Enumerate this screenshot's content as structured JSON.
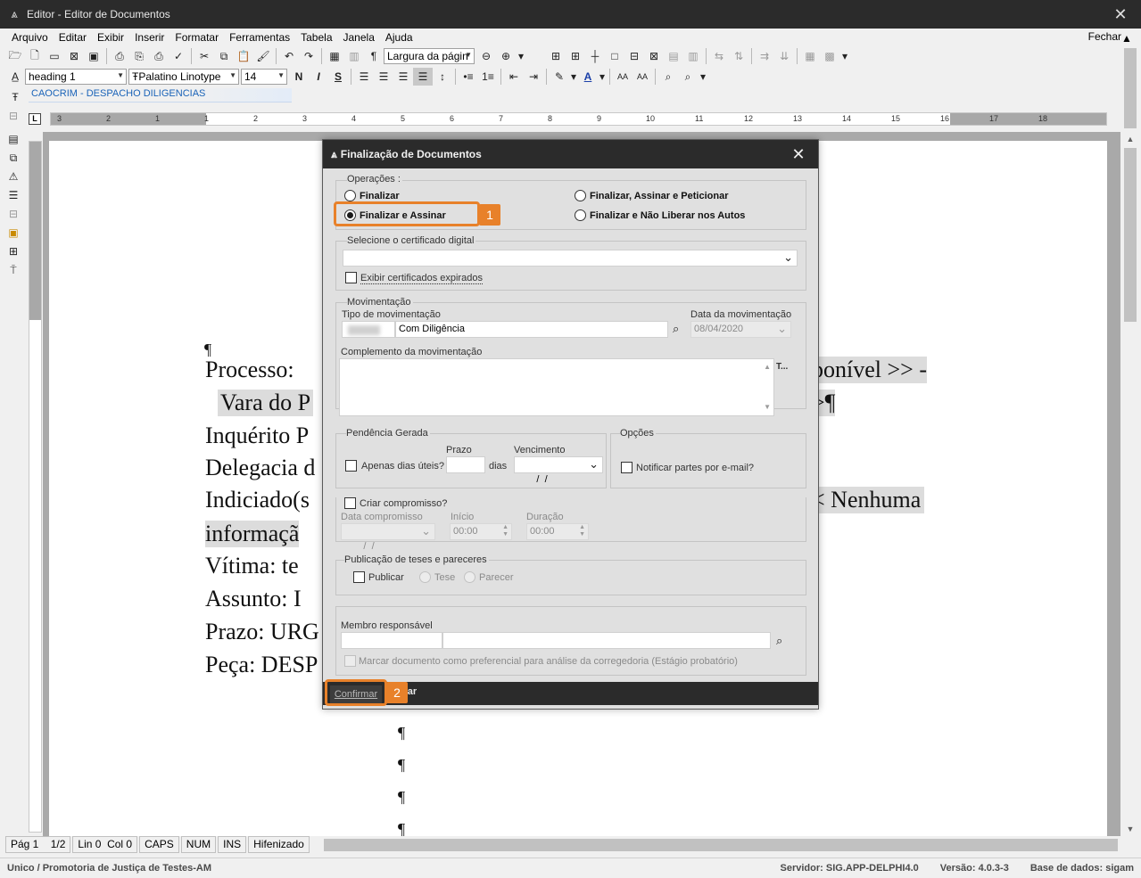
{
  "window": {
    "title": "Editor - Editor de Documentos"
  },
  "menu": {
    "items": [
      "Arquivo",
      "Editar",
      "Exibir",
      "Inserir",
      "Formatar",
      "Ferramentas",
      "Tabela",
      "Janela",
      "Ajuda"
    ],
    "close_label": "Fechar"
  },
  "toolbar": {
    "zoom_value": "Largura da págin",
    "style_value": "heading 1",
    "font_value": "Palatino Linotype",
    "size_value": "14"
  },
  "template_tab": "CAOCRIM - DESPACHO DILIGENCIAS",
  "ruler": {
    "numbers": [
      "3",
      "2",
      "1",
      "1",
      "2",
      "3",
      "4",
      "5",
      "6",
      "7",
      "8",
      "9",
      "10",
      "11",
      "12",
      "13",
      "14",
      "15",
      "16",
      "17",
      "18"
    ]
  },
  "document": {
    "lines": [
      "Processo:",
      "Vara do P",
      "Inquérito P",
      "Delegacia d",
      "Indiciado(s",
      "informaçã",
      "Vítima:   te",
      "Assunto:   I",
      "Prazo: URG",
      "Peça: DESP"
    ],
    "right_fragments": [
      "ponível >>  -",
      ">¶",
      "<  Nenhuma"
    ],
    "pilcrow": "¶"
  },
  "statusbar": {
    "cells": [
      "Pág 1    1/2",
      "Lin 0  Col 0",
      "CAPS",
      "NUM",
      "INS",
      "Hifenizado"
    ]
  },
  "bottom": {
    "left": "Unico / Promotoria de Justiça de Testes-AM",
    "server": "Servidor: SIG.APP-DELPHI4.0",
    "version": "Versão: 4.0.3-3",
    "database": "Base de dados: sigam"
  },
  "dialog": {
    "title": "Finalização de Documentos",
    "operations_label": "Operações :",
    "op_finalizar": "Finalizar",
    "op_finalizar_assinar": "Finalizar e Assinar",
    "op_finalizar_assinar_peticionar": "Finalizar, Assinar e Peticionar",
    "op_finalizar_nao_liberar": "Finalizar e Não Liberar nos Autos",
    "selected_operation": "Finalizar e Assinar",
    "cert_label": "Selecione o certificado digital",
    "cert_value": "",
    "show_expired_label": "Exibir certificados expirados",
    "movimentacao_label": "Movimentação",
    "tipo_label": "Tipo de movimentação",
    "tipo_value": "Com Diligência",
    "data_label": "Data da movimentação",
    "data_value": "08/04/2020",
    "complemento_label": "Complemento da movimentação",
    "complemento_side": "T...",
    "pendencia_label": "Pendência Gerada",
    "apenas_dias_label": "Apenas dias úteis?",
    "prazo_label": "Prazo",
    "dias_label": "dias",
    "vencimento_label": "Vencimento",
    "vencimento_value": " /  /",
    "opcoes_label": "Opções",
    "notificar_label": "Notificar partes por e-mail?",
    "criar_compromisso_label": "Criar compromisso?",
    "data_compromisso_label": "Data compromisso",
    "data_compromisso_value": " /  /",
    "inicio_label": "Início",
    "inicio_value": "00:00",
    "duracao_label": "Duração",
    "duracao_value": "00:00",
    "publicacao_label": "Publicação de teses e pareceres",
    "publicar_label": "Publicar",
    "tese_label": "Tese",
    "parecer_label": "Parecer",
    "membro_label": "Membro responsável",
    "marcar_label": "Marcar documento como preferencial para análise da corregedoria (Estágio probatório)",
    "confirm_label": "Confirmar",
    "close_tail": "har"
  },
  "callouts": [
    "1",
    "2"
  ],
  "colors": {
    "callout": "#e8812a",
    "titlebar": "#2b2b2b",
    "link": "#1a63b8"
  }
}
